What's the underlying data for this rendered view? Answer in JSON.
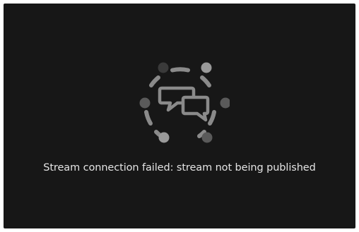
{
  "player": {
    "error_message": "Stream connection failed: stream not being published",
    "status_icon": "chat-bubbles-spinner-icon"
  },
  "colors": {
    "background": "#171717",
    "text": "#e4e4e4",
    "icon_stroke": "#8a8a8a",
    "dot": "#5a5a5a",
    "dot_highlight": "#9a9a9a",
    "dot_dim": "#3a3a3a"
  }
}
